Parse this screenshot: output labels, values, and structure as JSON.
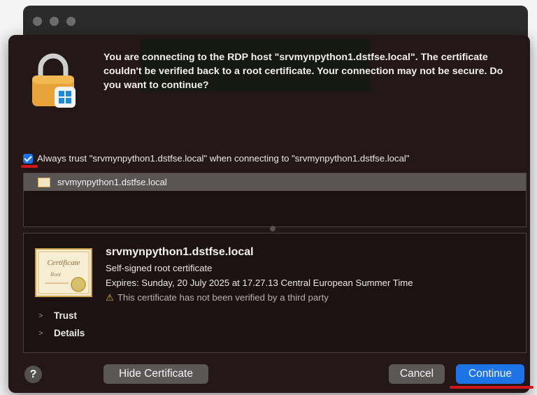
{
  "dialog": {
    "message": "You are connecting to the RDP host \"srvmynpython1.dstfse.local\". The certificate couldn't be verified back to a root certificate. Your connection may not be secure. Do you want to continue?",
    "always_trust_label": "Always trust \"srvmynpython1.dstfse.local\" when connecting to \"srvmynpython1.dstfse.local\"",
    "always_trust_checked": true,
    "icon": "lock-windows-icon"
  },
  "cert_list": {
    "items": [
      {
        "label": "srvmynpython1.dstfse.local",
        "icon": "certificate-icon",
        "selected": true
      }
    ]
  },
  "cert_details": {
    "name": "srvmynpython1.dstfse.local",
    "type": "Self-signed root certificate",
    "expires": "Expires: Sunday, 20 July 2025 at 17.27.13 Central European Summer Time",
    "warning": "This certificate has not been verified by a third party",
    "warning_icon": "warning-icon",
    "image_text": "Certificate",
    "image_subtext": "Root",
    "sections": [
      {
        "label": "Trust"
      },
      {
        "label": "Details"
      }
    ]
  },
  "buttons": {
    "help": "?",
    "hide_certificate": "Hide Certificate",
    "cancel": "Cancel",
    "continue": "Continue"
  },
  "colors": {
    "dialog_bg": "#231717",
    "accent_blue": "#1d74e6",
    "annotation_red": "#d3151c"
  }
}
